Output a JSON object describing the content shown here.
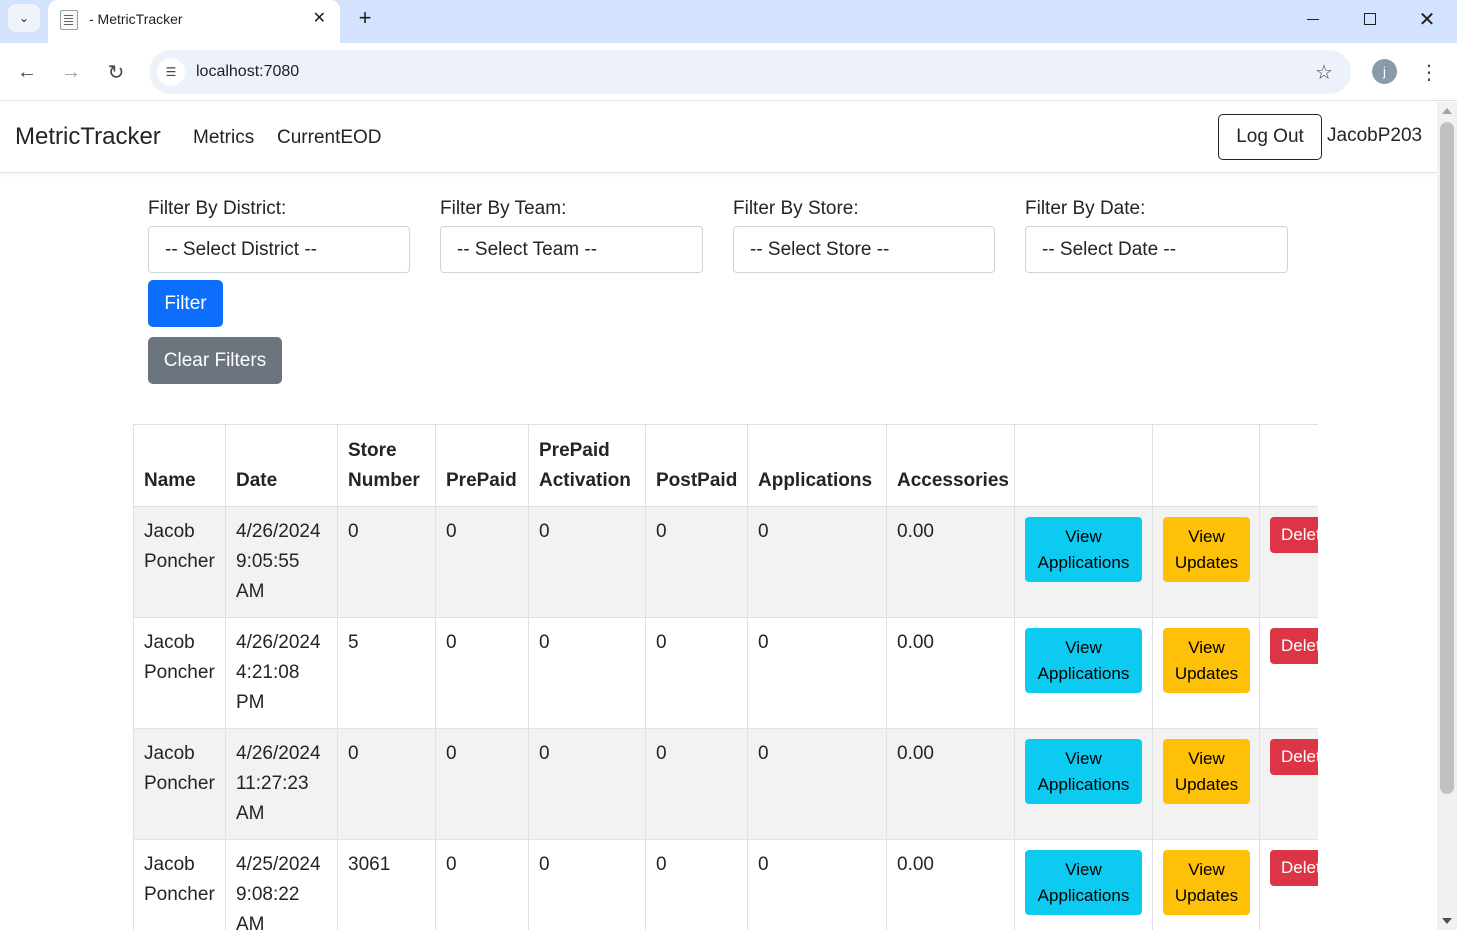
{
  "browser": {
    "tab_title": "- MetricTracker",
    "url": "localhost:7080",
    "profile_initial": "j"
  },
  "navbar": {
    "brand": "MetricTracker",
    "links": [
      "Metrics",
      "CurrentEOD"
    ],
    "logout_label": "Log Out",
    "username": "JacobP203"
  },
  "filters": {
    "district": {
      "label": "Filter By District:",
      "value": "-- Select District --"
    },
    "team": {
      "label": "Filter By Team:",
      "value": "-- Select Team --"
    },
    "store": {
      "label": "Filter By Store:",
      "value": "-- Select Store --"
    },
    "date": {
      "label": "Filter By Date:",
      "value": "-- Select Date --"
    },
    "filter_label": "Filter",
    "clear_label": "Clear Filters"
  },
  "table": {
    "headers": [
      "Name",
      "Date",
      "Store Number",
      "PrePaid",
      "PrePaid Activation",
      "PostPaid",
      "Applications",
      "Accessories"
    ],
    "view_apps_label": "View Applications",
    "view_updates_label": "View Updates",
    "delete_label": "Delete",
    "rows": [
      {
        "name": "Jacob Poncher",
        "date": "4/26/2024 9:05:55 AM",
        "store": "0",
        "prepaid": "0",
        "prepaid_activation": "0",
        "postpaid": "0",
        "applications": "0",
        "accessories": "0.00"
      },
      {
        "name": "Jacob Poncher",
        "date": "4/26/2024 4:21:08 PM",
        "store": "5",
        "prepaid": "0",
        "prepaid_activation": "0",
        "postpaid": "0",
        "applications": "0",
        "accessories": "0.00"
      },
      {
        "name": "Jacob Poncher",
        "date": "4/26/2024 11:27:23 AM",
        "store": "0",
        "prepaid": "0",
        "prepaid_activation": "0",
        "postpaid": "0",
        "applications": "0",
        "accessories": "0.00"
      },
      {
        "name": "Jacob Poncher",
        "date": "4/25/2024 9:08:22 AM",
        "store": "3061",
        "prepaid": "0",
        "prepaid_activation": "0",
        "postpaid": "0",
        "applications": "0",
        "accessories": "0.00"
      }
    ]
  },
  "colors": {
    "primary": "#0d6efd",
    "secondary": "#6c757d",
    "info": "#0dcaf0",
    "warning": "#ffc107",
    "danger": "#dc3545"
  }
}
